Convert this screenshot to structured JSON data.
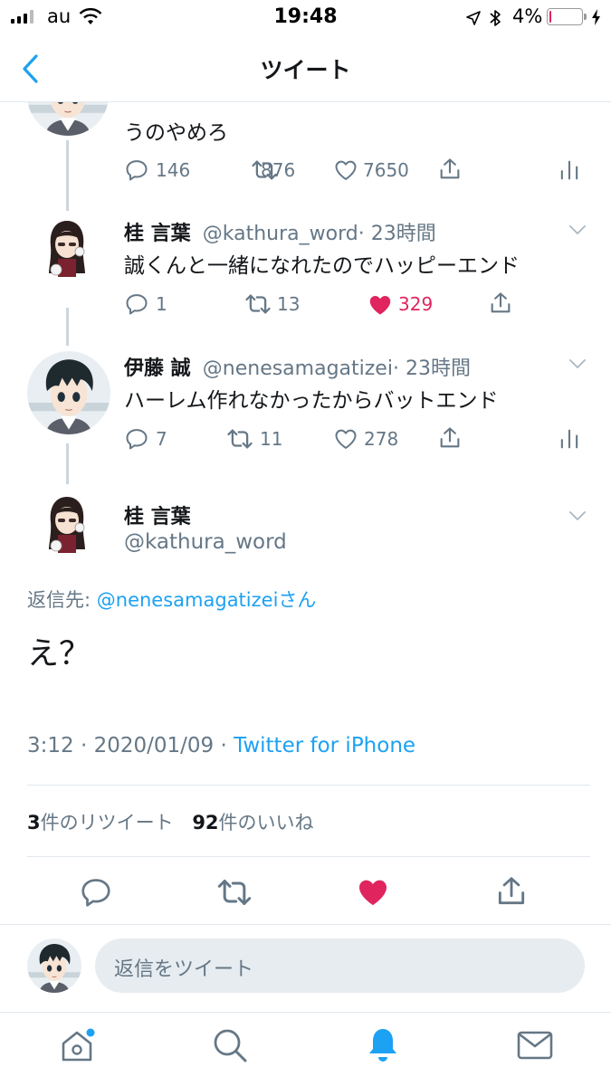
{
  "status_bar": {
    "carrier": "au",
    "time": "19:48",
    "battery_percent": "4%",
    "battery_level": 0.04
  },
  "nav": {
    "title": "ツイート",
    "back_icon": "chevron-left-icon"
  },
  "tweets": [
    {
      "text": "うのやめろ",
      "reply_count": "146",
      "retweet_count": "876",
      "like_count": "7650",
      "liked": false
    },
    {
      "name": "桂 言葉",
      "handle": "@kathura_word",
      "time": "· 23時間",
      "text": "誠くんと一緒になれたのでハッピーエンド",
      "reply_count": "1",
      "retweet_count": "13",
      "like_count": "329",
      "liked": true
    },
    {
      "name": "伊藤 誠",
      "handle": "@nenesamagatizei",
      "time": "· 23時間",
      "text": "ハーレム作れなかったからバットエンド",
      "reply_count": "7",
      "retweet_count": "11",
      "like_count": "278",
      "liked": false
    }
  ],
  "main_tweet": {
    "name": "桂 言葉",
    "handle": "@kathura_word",
    "reply_to_label": "返信先: ",
    "reply_to_handle": "@nenesamagatizeiさん",
    "text": "え？",
    "timestamp": "3:12 · 2020/01/09 · ",
    "source": "Twitter for iPhone",
    "retweet_count": "3",
    "retweet_label": "件のリツイート",
    "like_count": "92",
    "like_label": "件のいいね"
  },
  "reply_bar": {
    "placeholder": "返信をツイート"
  },
  "tab_bar": {
    "items": [
      "home-icon",
      "search-icon",
      "notifications-icon",
      "messages-icon"
    ]
  },
  "colors": {
    "accent": "#1da1f2",
    "like": "#e0245e",
    "text": "#14171a",
    "secondary": "#657786"
  }
}
